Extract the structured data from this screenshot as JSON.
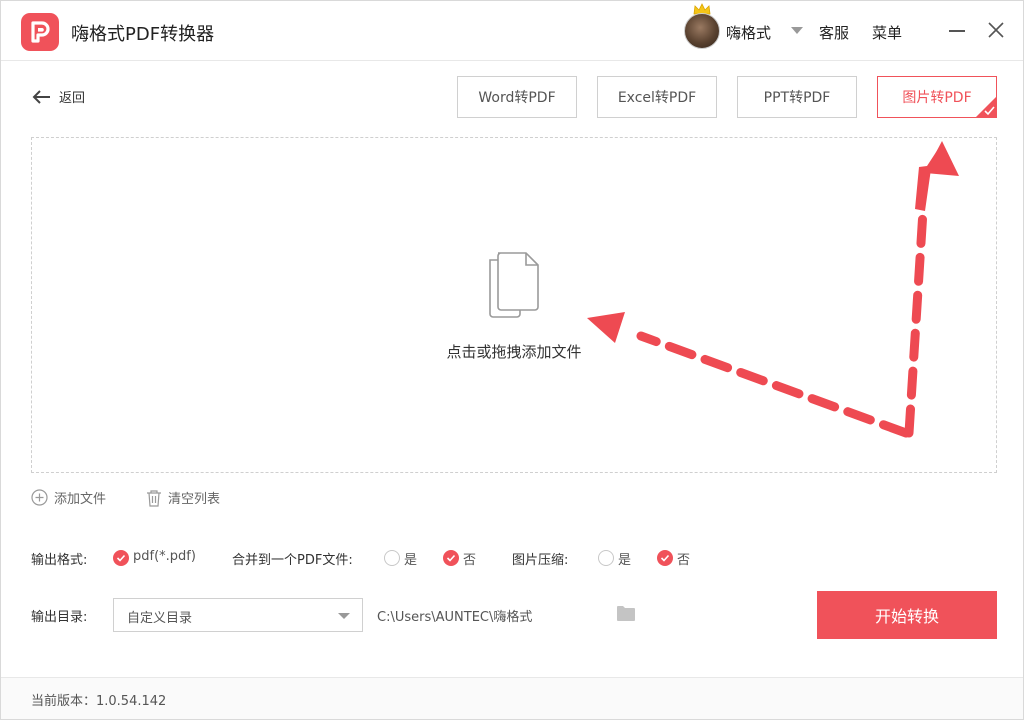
{
  "app": {
    "title": "嗨格式PDF转换器",
    "brand_color": "#f0525a"
  },
  "header": {
    "username": "嗨格式",
    "support_label": "客服",
    "menu_label": "菜单"
  },
  "nav": {
    "back_label": "返回"
  },
  "tabs": [
    {
      "label": "Word转PDF",
      "active": false
    },
    {
      "label": "Excel转PDF",
      "active": false
    },
    {
      "label": "PPT转PDF",
      "active": false
    },
    {
      "label": "图片转PDF",
      "active": true
    }
  ],
  "dropzone": {
    "text": "点击或拖拽添加文件",
    "icon": "document-copy-icon"
  },
  "actions": {
    "add_file": "添加文件",
    "clear_list": "清空列表"
  },
  "options": {
    "output_format_label": "输出格式:",
    "output_format_value": "pdf(*.pdf)",
    "merge_label": "合并到一个PDF文件:",
    "merge_yes": "是",
    "merge_no": "否",
    "merge_selected": "否",
    "compress_label": "图片压缩:",
    "compress_yes": "是",
    "compress_no": "否",
    "compress_selected": "否"
  },
  "output": {
    "dir_label": "输出目录:",
    "dir_select_value": "自定义目录",
    "path": "C:\\Users\\AUNTEC\\嗨格式"
  },
  "start_button": "开始转换",
  "footer": {
    "version": "当前版本：1.0.54.142"
  }
}
